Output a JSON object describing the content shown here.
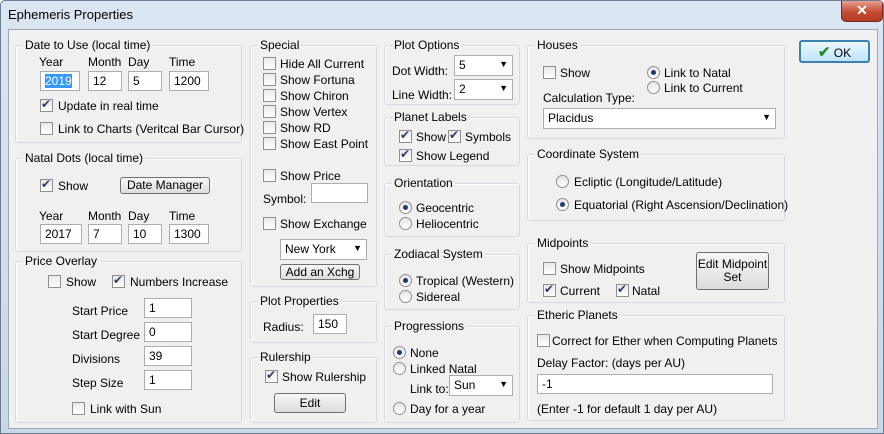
{
  "window": {
    "title": "Ephemeris Properties",
    "close_glyph": "✕"
  },
  "ok_button": {
    "label": "OK",
    "icon": "check-icon"
  },
  "date_to_use": {
    "title": "Date to Use (local time)",
    "headers": [
      "Year",
      "Month",
      "Day",
      "Time"
    ],
    "values": [
      "2019",
      "12",
      "5",
      "1200"
    ],
    "update_realtime": {
      "label": "Update in real time",
      "checked": true
    },
    "link_to_charts": {
      "label": "Link to Charts (Veritcal Bar Cursor)",
      "checked": false
    }
  },
  "natal_dots": {
    "title": "Natal Dots (local time)",
    "show": {
      "label": "Show",
      "checked": true
    },
    "date_manager_label": "Date Manager",
    "headers": [
      "Year",
      "Month",
      "Day",
      "Time"
    ],
    "values": [
      "2017",
      "7",
      "10",
      "1300"
    ]
  },
  "price_overlay": {
    "title": "Price Overlay",
    "show": {
      "label": "Show",
      "checked": false
    },
    "numbers_increase": {
      "label": "Numbers Increase",
      "checked": true
    },
    "fields": [
      {
        "label": "Start Price",
        "value": "1"
      },
      {
        "label": "Start Degree",
        "value": "0"
      },
      {
        "label": "Divisions",
        "value": "39"
      },
      {
        "label": "Step Size",
        "value": "1"
      }
    ],
    "link_with_sun": {
      "label": "Link with Sun",
      "checked": false
    }
  },
  "special": {
    "title": "Special",
    "items": [
      {
        "label": "Hide All Current",
        "checked": false
      },
      {
        "label": "Show Fortuna",
        "checked": false
      },
      {
        "label": "Show Chiron",
        "checked": false
      },
      {
        "label": "Show Vertex",
        "checked": false
      },
      {
        "label": "Show RD",
        "checked": false
      },
      {
        "label": "Show East Point",
        "checked": false
      }
    ],
    "show_price": {
      "label": "Show Price",
      "checked": false
    },
    "symbol_label": "Symbol:",
    "symbol_value": "",
    "show_exchange": {
      "label": "Show Exchange",
      "checked": false
    },
    "exchange_selected": "New York",
    "add_xchg_label": "Add an Xchg"
  },
  "plot_properties": {
    "title": "Plot Properties",
    "radius_label": "Radius:",
    "radius_value": "150"
  },
  "rulership": {
    "title": "Rulership",
    "show": {
      "label": "Show Rulership",
      "checked": true
    },
    "edit_label": "Edit"
  },
  "plot_options": {
    "title": "Plot Options",
    "dot_width_label": "Dot Width:",
    "dot_width_value": "5",
    "line_width_label": "Line Width:",
    "line_width_value": "2"
  },
  "planet_labels": {
    "title": "Planet Labels",
    "show": {
      "label": "Show",
      "checked": true
    },
    "symbols": {
      "label": "Symbols",
      "checked": true
    },
    "show_legend": {
      "label": "Show Legend",
      "checked": true
    }
  },
  "orientation": {
    "title": "Orientation",
    "options": [
      {
        "label": "Geocentric",
        "selected": true
      },
      {
        "label": "Heliocentric",
        "selected": false
      }
    ]
  },
  "zodiacal": {
    "title": "Zodiacal System",
    "options": [
      {
        "label": "Tropical (Western)",
        "selected": true
      },
      {
        "label": "Sidereal",
        "selected": false
      }
    ]
  },
  "progressions": {
    "title": "Progressions",
    "none": {
      "label": "None",
      "selected": true
    },
    "linked_natal": {
      "label": "Linked Natal",
      "selected": false
    },
    "link_to_label": "Link to:",
    "link_to_value": "Sun",
    "day_for_year": {
      "label": "Day for a year",
      "selected": false
    }
  },
  "houses": {
    "title": "Houses",
    "show": {
      "label": "Show",
      "checked": false
    },
    "link_natal": {
      "label": "Link to Natal",
      "selected": true
    },
    "link_current": {
      "label": "Link to Current",
      "selected": false
    },
    "calc_type_label": "Calculation Type:",
    "calc_type_value": "Placidus"
  },
  "coordinate": {
    "title": "Coordinate System",
    "ecliptic": {
      "label": "Ecliptic (Longitude/Latitude)",
      "selected": false
    },
    "equatorial": {
      "label": "Equatorial (Right Ascension/Declination)",
      "selected": true
    }
  },
  "midpoints": {
    "title": "Midpoints",
    "show": {
      "label": "Show Midpoints",
      "checked": false
    },
    "current": {
      "label": "Current",
      "checked": true
    },
    "natal": {
      "label": "Natal",
      "checked": true
    },
    "edit_line1": "Edit Midpoint",
    "edit_line2": "Set"
  },
  "etheric": {
    "title": "Etheric Planets",
    "correct": {
      "label": "Correct for Ether when Computing Planets",
      "checked": false
    },
    "delay_label": "Delay Factor: (days per AU)",
    "delay_value": "-1",
    "hint": "(Enter -1 for default 1 day per AU)"
  }
}
